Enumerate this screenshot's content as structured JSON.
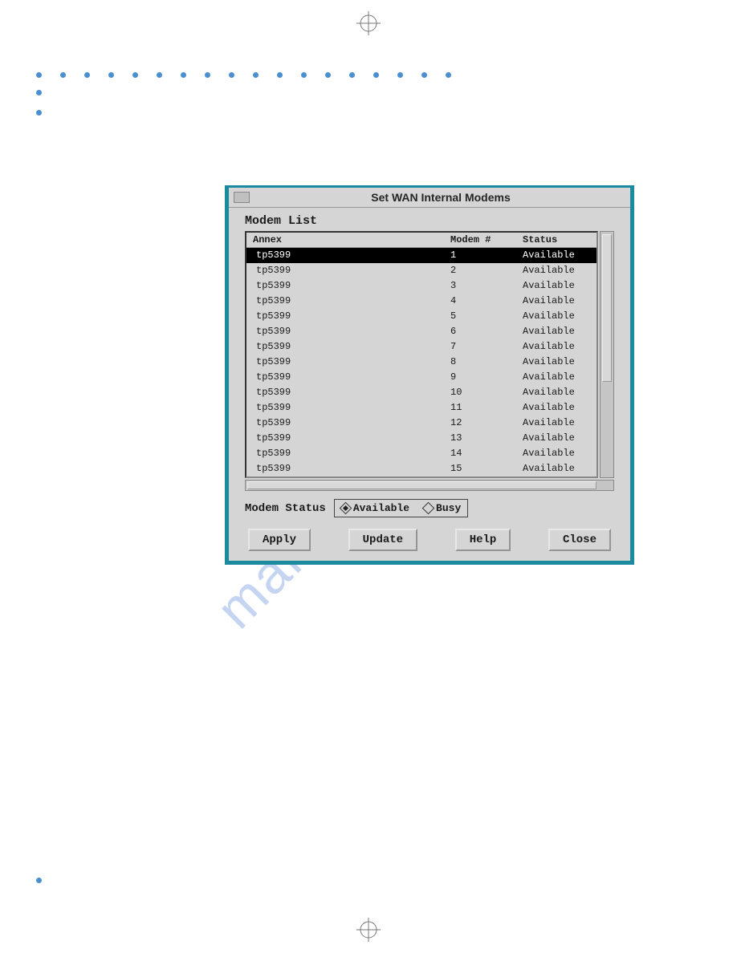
{
  "dialog": {
    "title": "Set WAN Internal Modems",
    "list_label": "Modem List",
    "columns": {
      "annex": "Annex",
      "modem": "Modem #",
      "status": "Status"
    },
    "rows": [
      {
        "annex": "tp5399",
        "modem": "1",
        "status": "Available",
        "selected": true
      },
      {
        "annex": "tp5399",
        "modem": "2",
        "status": "Available",
        "selected": false
      },
      {
        "annex": "tp5399",
        "modem": "3",
        "status": "Available",
        "selected": false
      },
      {
        "annex": "tp5399",
        "modem": "4",
        "status": "Available",
        "selected": false
      },
      {
        "annex": "tp5399",
        "modem": "5",
        "status": "Available",
        "selected": false
      },
      {
        "annex": "tp5399",
        "modem": "6",
        "status": "Available",
        "selected": false
      },
      {
        "annex": "tp5399",
        "modem": "7",
        "status": "Available",
        "selected": false
      },
      {
        "annex": "tp5399",
        "modem": "8",
        "status": "Available",
        "selected": false
      },
      {
        "annex": "tp5399",
        "modem": "9",
        "status": "Available",
        "selected": false
      },
      {
        "annex": "tp5399",
        "modem": "10",
        "status": "Available",
        "selected": false
      },
      {
        "annex": "tp5399",
        "modem": "11",
        "status": "Available",
        "selected": false
      },
      {
        "annex": "tp5399",
        "modem": "12",
        "status": "Available",
        "selected": false
      },
      {
        "annex": "tp5399",
        "modem": "13",
        "status": "Available",
        "selected": false
      },
      {
        "annex": "tp5399",
        "modem": "14",
        "status": "Available",
        "selected": false
      },
      {
        "annex": "tp5399",
        "modem": "15",
        "status": "Available",
        "selected": false
      }
    ],
    "status_section": {
      "label": "Modem Status",
      "options": {
        "available": "Available",
        "busy": "Busy"
      },
      "selected": "available"
    },
    "buttons": {
      "apply": "Apply",
      "update": "Update",
      "help": "Help",
      "close": "Close"
    }
  },
  "watermark": "manualshive.co"
}
